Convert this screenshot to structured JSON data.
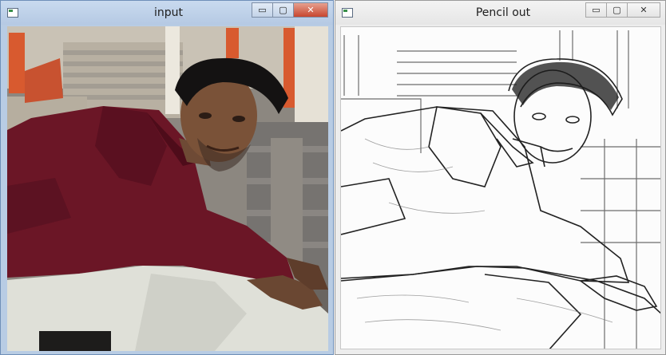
{
  "windows": {
    "input": {
      "title": "input",
      "controls": {
        "minimize_icon": "minimize-icon",
        "maximize_icon": "maximize-icon",
        "close_icon": "close-icon"
      },
      "controls_glyphs": {
        "minimize": "▭",
        "maximize": "▢",
        "close": "✕"
      }
    },
    "pencil": {
      "title": "Pencil out",
      "controls": {
        "minimize_icon": "minimize-icon",
        "maximize_icon": "maximize-icon",
        "close_icon": "close-icon"
      },
      "controls_glyphs": {
        "minimize": "▭",
        "maximize": "▢",
        "close": "✕"
      }
    }
  },
  "colors": {
    "shirt": "#6b1626",
    "pants": "#dfe0d8",
    "accent_pillar": "#d85a2f",
    "close_button": "#c7462f"
  }
}
